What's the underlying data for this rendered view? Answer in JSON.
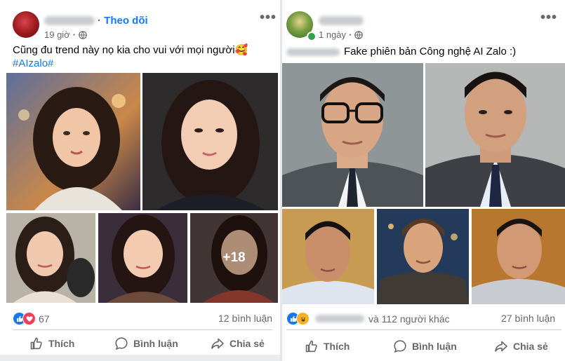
{
  "left_post": {
    "follow_label": "Theo dõi",
    "time": "19 giờ",
    "caption": "Cũng đu trend này nọ kia cho vui với mọi người🥰",
    "hashtag": "#AIzalo#",
    "more_label": "•••",
    "photo_overlay": "+18",
    "reaction_count": "67",
    "comment_count": "12 bình luận",
    "actions": {
      "like": "Thích",
      "comment": "Bình luận",
      "share": "Chia sẻ"
    },
    "colors": {
      "avatar": "#9a1a1e",
      "portrait_bg": "#3b3f54"
    }
  },
  "right_post": {
    "time": "1 ngày",
    "caption": "Fake phiên bản Công nghệ AI Zalo :)",
    "more_label": "•••",
    "reaction_text": "và 112 người khác",
    "comment_count": "27 bình luận",
    "actions": {
      "like": "Thích",
      "comment": "Bình luận",
      "share": "Chia sẻ"
    },
    "colors": {
      "avatar": "#3d6b1f",
      "online": "#31a24c"
    }
  },
  "colors": {
    "link_blue": "#1877f2",
    "text_secondary": "#65676b",
    "like_blue": "#1877f2",
    "love_red": "#f33e58",
    "haha_yellow": "#f7b125"
  },
  "icons": [
    "globe-icon",
    "like-reaction-icon",
    "love-reaction-icon",
    "haha-reaction-icon",
    "thumbs-up-icon",
    "comment-bubble-icon",
    "share-arrow-icon",
    "more-options-icon"
  ]
}
